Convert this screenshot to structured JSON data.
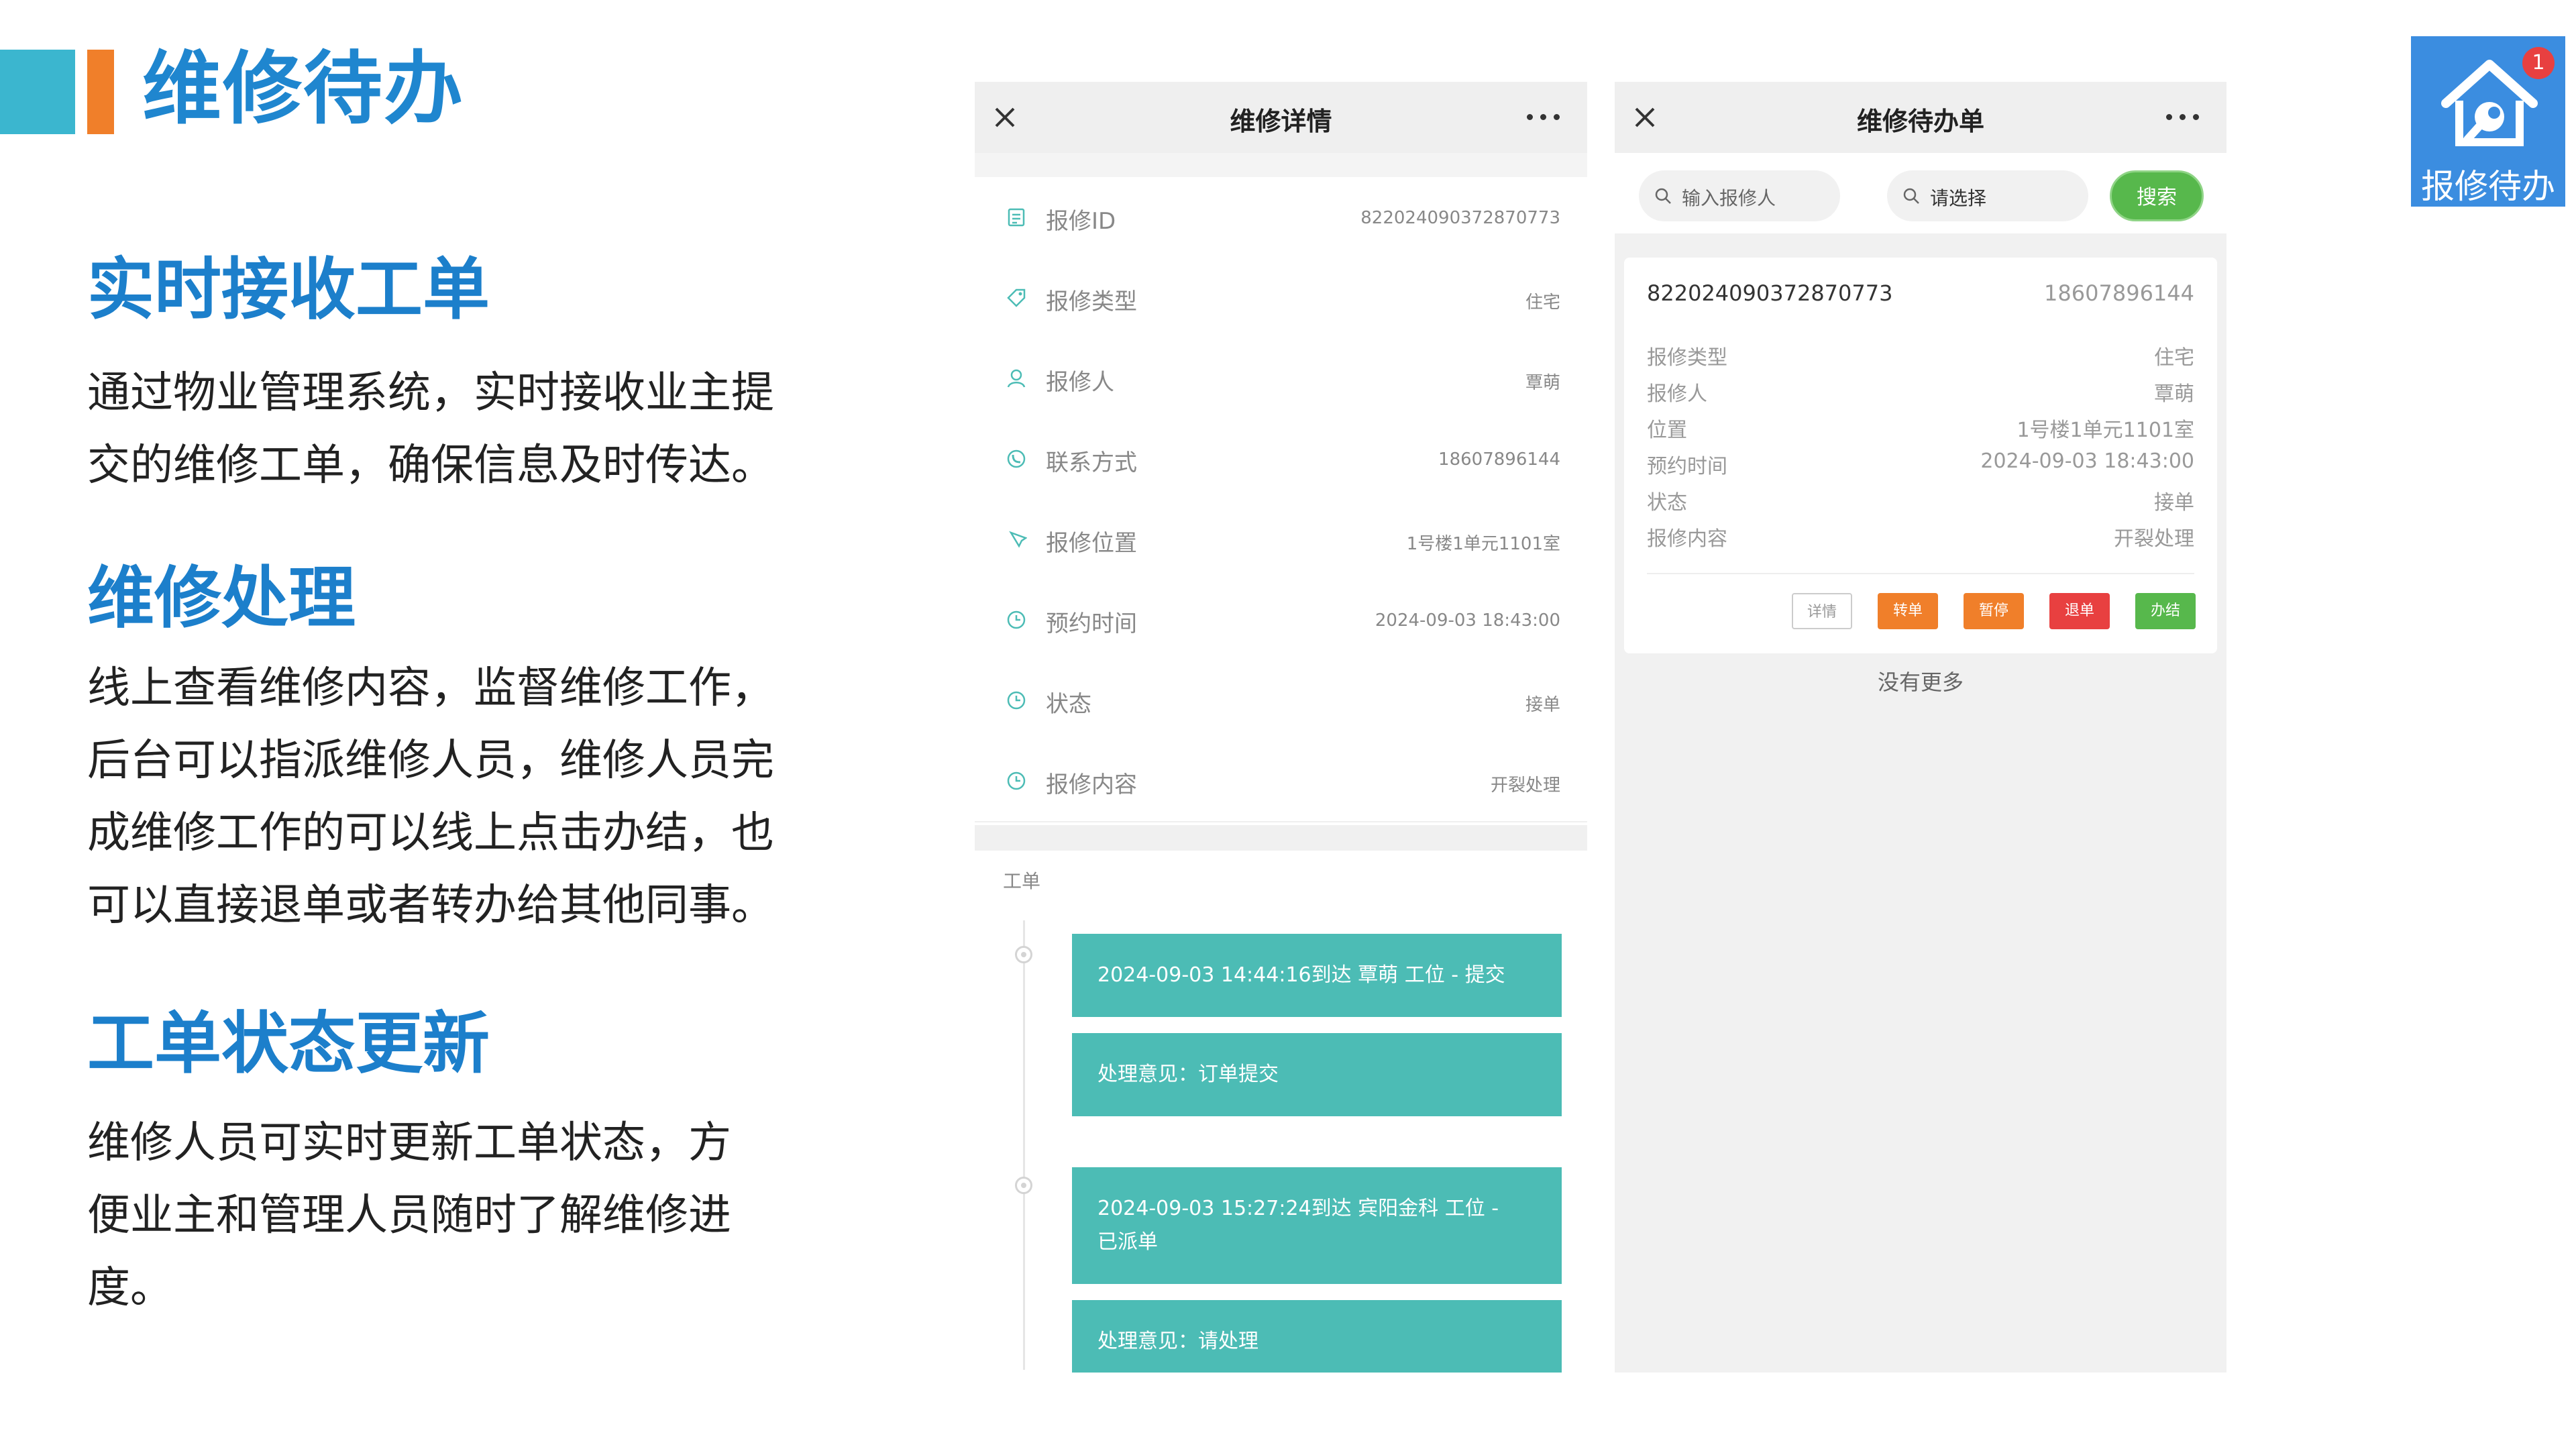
{
  "page": {
    "title": "维修待办"
  },
  "sections": [
    {
      "heading": "实时接收工单",
      "lines": [
        "通过物业管理系统，实时接收业主提",
        "交的维修工单，确保信息及时传达。"
      ]
    },
    {
      "heading": "维修处理",
      "lines": [
        "线上查看维修内容，监督维修工作，",
        "后台可以指派维修人员，维修人员完",
        "成维修工作的可以线上点击办结，也",
        "可以直接退单或者转办给其他同事。"
      ]
    },
    {
      "heading": "工单状态更新",
      "lines": [
        "维修人员可实时更新工单状态，方",
        "便业主和管理人员随时了解维修进",
        "度。"
      ]
    }
  ],
  "detail_panel": {
    "title": "维修详情",
    "rows": [
      {
        "label": "报修ID",
        "value": "822024090372870773",
        "icon": "note-icon"
      },
      {
        "label": "报修类型",
        "value": "住宅",
        "icon": "tag-icon"
      },
      {
        "label": "报修人",
        "value": "覃萌",
        "icon": "user-icon"
      },
      {
        "label": "联系方式",
        "value": "18607896144",
        "icon": "phone-icon"
      },
      {
        "label": "报修位置",
        "value": "1号楼1单元1101室",
        "icon": "location-icon"
      },
      {
        "label": "预约时间",
        "value": "2024-09-03 18:43:00",
        "icon": "clock-icon"
      },
      {
        "label": "状态",
        "value": "接单",
        "icon": "clock-icon"
      },
      {
        "label": "报修内容",
        "value": "开裂处理",
        "icon": "clock-icon"
      }
    ],
    "work_order_label": "工单",
    "timeline": [
      {
        "event": "2024-09-03 14:44:16到达 覃萌 工位 - 提交",
        "opinion": "处理意见：订单提交"
      },
      {
        "event_line1": "2024-09-03 15:27:24到达 宾阳金科 工位 -",
        "event_line2": "已派单",
        "opinion": "处理意见：请处理"
      }
    ]
  },
  "list_panel": {
    "title": "维修待办单",
    "search_placeholder": "输入报修人",
    "select_placeholder": "请选择",
    "search_button": "搜索",
    "card": {
      "id": "822024090372870773",
      "phone": "18607896144",
      "fields": [
        {
          "label": "报修类型",
          "value": "住宅"
        },
        {
          "label": "报修人",
          "value": "覃萌"
        },
        {
          "label": "位置",
          "value": "1号楼1单元1101室"
        },
        {
          "label": "预约时间",
          "value": "2024-09-03 18:43:00"
        },
        {
          "label": "状态",
          "value": "接单"
        },
        {
          "label": "报修内容",
          "value": "开裂处理"
        }
      ],
      "actions": [
        {
          "label": "详情",
          "color": "#ffffff"
        },
        {
          "label": "转单",
          "color": "#f07f2a"
        },
        {
          "label": "暂停",
          "color": "#f07f2a"
        },
        {
          "label": "退单",
          "color": "#e84040"
        },
        {
          "label": "办结",
          "color": "#57b84c"
        }
      ]
    },
    "no_more": "没有更多"
  },
  "corner": {
    "label": "报修待办",
    "badge_count": "1"
  },
  "colors": {
    "accent_blue": "#1f86cf",
    "teal": "#4cbcb5",
    "orange": "#f07f2a",
    "red": "#e84040",
    "green": "#57b84c"
  }
}
